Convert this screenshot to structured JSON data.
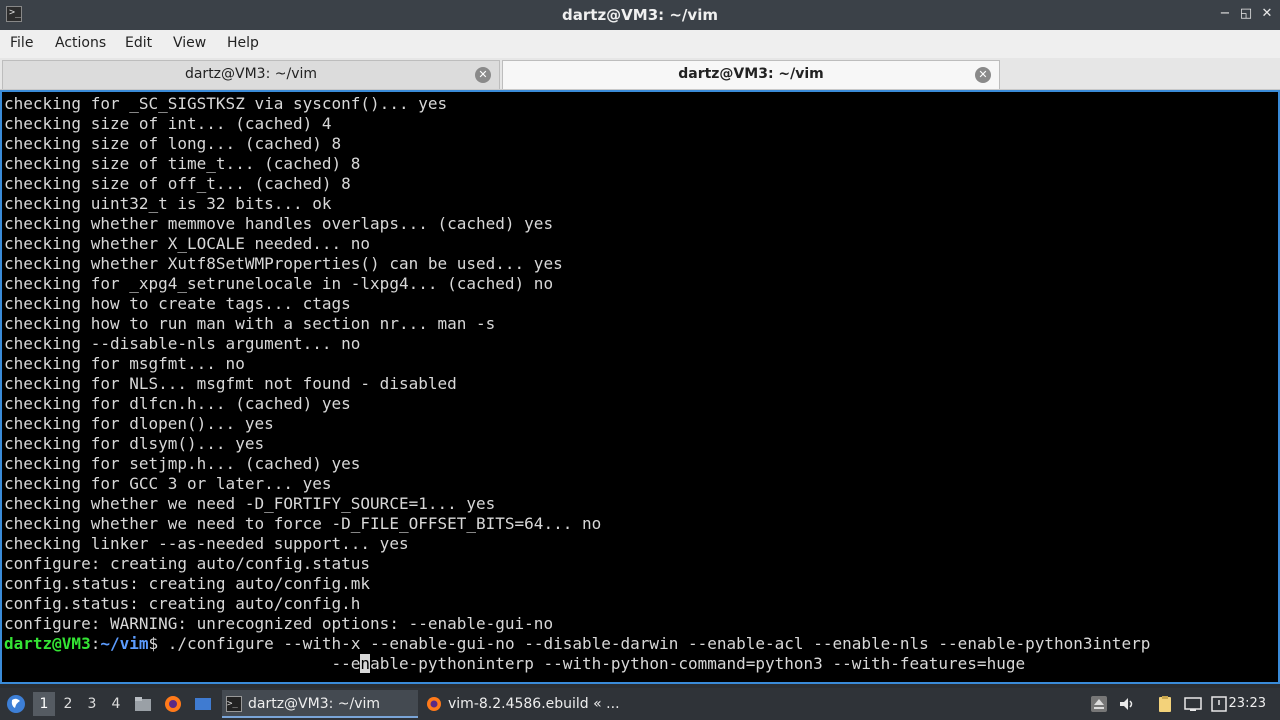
{
  "window": {
    "title": "dartz@VM3: ~/vim",
    "minimize": "−",
    "maximize": "◱",
    "close": "✕",
    "app_icon": "terminal-icon"
  },
  "menu": [
    "File",
    "Actions",
    "Edit",
    "View",
    "Help"
  ],
  "tabs": [
    {
      "label": "dartz@VM3: ~/vim",
      "active": false
    },
    {
      "label": "dartz@VM3: ~/vim",
      "active": true
    }
  ],
  "terminal": {
    "lines": [
      "checking for _SC_SIGSTKSZ via sysconf()... yes",
      "checking size of int... (cached) 4",
      "checking size of long... (cached) 8",
      "checking size of time_t... (cached) 8",
      "checking size of off_t... (cached) 8",
      "checking uint32_t is 32 bits... ok",
      "checking whether memmove handles overlaps... (cached) yes",
      "checking whether X_LOCALE needed... no",
      "checking whether Xutf8SetWMProperties() can be used... yes",
      "checking for _xpg4_setrunelocale in -lxpg4... (cached) no",
      "checking how to create tags... ctags",
      "checking how to run man with a section nr... man -s",
      "checking --disable-nls argument... no",
      "checking for msgfmt... no",
      "checking for NLS... msgfmt not found - disabled",
      "checking for dlfcn.h... (cached) yes",
      "checking for dlopen()... yes",
      "checking for dlsym()... yes",
      "checking for setjmp.h... (cached) yes",
      "checking for GCC 3 or later... yes",
      "checking whether we need -D_FORTIFY_SOURCE=1... yes",
      "checking whether we need to force -D_FILE_OFFSET_BITS=64... no",
      "checking linker --as-needed support... yes",
      "configure: creating auto/config.status",
      "config.status: creating auto/config.mk",
      "config.status: creating auto/config.h",
      "configure: WARNING: unrecognized options: --enable-gui-no"
    ],
    "prompt_user": "dartz@VM3",
    "prompt_sep": ":",
    "prompt_path": "~/vim",
    "prompt_dollar": "$",
    "command": " ./configure --with-x --enable-gui-no --disable-darwin --enable-acl --enable-nls --enable-python3interp",
    "continuation_before_cursor": "                                  --e",
    "cursor_char": "n",
    "continuation_after_cursor": "able-pythoninterp --with-python-command=python3 --with-features=huge"
  },
  "taskbar": {
    "desktops": [
      "1",
      "2",
      "3",
      "4"
    ],
    "active_desktop": "1",
    "tasks": [
      {
        "label": "dartz@VM3: ~/vim",
        "icon": "terminal-icon",
        "active": true
      },
      {
        "label": "vim-8.2.4586.ebuild « ...",
        "icon": "firefox-icon",
        "active": false
      }
    ],
    "clock": "23:23"
  }
}
